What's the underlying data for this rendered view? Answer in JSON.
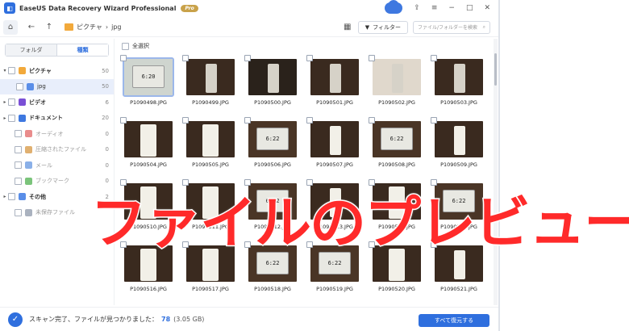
{
  "window": {
    "title": "EaseUS Data Recovery Wizard Professional",
    "badge": "Pro",
    "controls": {
      "minimize": "−",
      "maximize": "□",
      "close": "✕",
      "menu": "≡",
      "upload": "⇪"
    }
  },
  "nav": {
    "home": "⌂",
    "back": "←",
    "up": "↑",
    "breadcrumb": [
      "ピクチャ",
      "jpg"
    ],
    "separator": "›",
    "view_icon": "▦",
    "filter_label": "フィルター",
    "search_placeholder": "ファイル/フォルダーを検索"
  },
  "sidebar": {
    "tabs": [
      "フォルダ",
      "種類"
    ],
    "active_tab": "種類",
    "items": [
      {
        "label": "ピクチャ",
        "count": "50",
        "color": "#f2a93b",
        "bold": true
      },
      {
        "label": "jpg",
        "count": "50",
        "color": "#5a8ee8",
        "bold": false
      },
      {
        "label": "ビデオ",
        "count": "6",
        "color": "#7a4fd6",
        "bold": true
      },
      {
        "label": "ドキュメント",
        "count": "20",
        "color": "#3e78e0",
        "bold": true
      },
      {
        "label": "オーディオ",
        "count": "0",
        "color": "#e98c8c",
        "bold": false
      },
      {
        "label": "圧縮されたファイル",
        "count": "0",
        "color": "#e0b070",
        "bold": false
      },
      {
        "label": "メール",
        "count": "0",
        "color": "#8ab0e8",
        "bold": false
      },
      {
        "label": "ブックマーク",
        "count": "0",
        "color": "#7bc47b",
        "bold": false
      },
      {
        "label": "その他",
        "count": "2",
        "color": "#5a8ee8",
        "bold": true
      },
      {
        "label": "未保存ファイル",
        "count": "",
        "color": "#aab2bf",
        "bold": false
      }
    ]
  },
  "main": {
    "select_all": "全選択",
    "files": [
      "P1090498.JPG",
      "P1090499.JPG",
      "P1090500.JPG",
      "P1090501.JPG",
      "P1090502.JPG",
      "P1090503.JPG",
      "P1090504.JPG",
      "P1090505.JPG",
      "P1090506.JPG",
      "P1090507.JPG",
      "P1090508.JPG",
      "P1090509.JPG",
      "P1090510.JPG",
      "P1090511.JPG",
      "P1090512.JPG",
      "P1090513.JPG",
      "P1090514.JPG",
      "P1090515.JPG",
      "P1090516.JPG",
      "P1090517.JPG",
      "P1090518.JPG",
      "P1090519.JPG",
      "P1090520.JPG",
      "P1090521.JPG"
    ],
    "clock_text": "6:20",
    "clock_text_2": "6:22"
  },
  "status": {
    "check_icon": "✓",
    "message": "スキャン完了、ファイルが見つかりました：",
    "count": "78",
    "size": "(3.05 GB)",
    "restore_button": "すべて復元する"
  },
  "overlay": {
    "text": "ファイルのプレビュー"
  }
}
